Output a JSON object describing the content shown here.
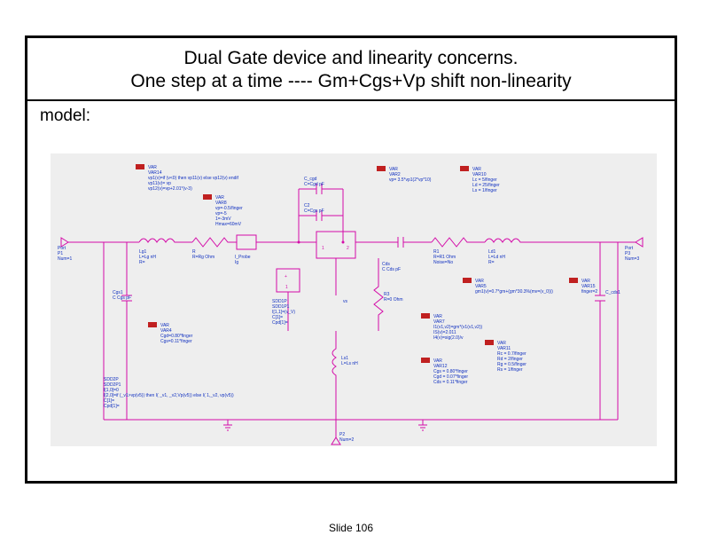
{
  "title": {
    "line1": "Dual Gate device and linearity concerns.",
    "line2": "One step at a time ----    Gm+Cgs+Vp shift non-linearity"
  },
  "model_label": "model:",
  "footer": "Slide 106",
  "schematic": {
    "vars": [
      {
        "id": "VAR14",
        "name": "VAR",
        "lines": [
          "vp1(v)=if (v<0) then vp11(v) else vp12(v) endif",
          "vp11(v)= vp",
          "vp12(v)=vp+2.01*(v-3)"
        ]
      },
      {
        "id": "VAR8",
        "name": "VAR",
        "lines": [
          "vp=-0.5/finger",
          "vp=-5",
          "1=-3mV",
          "Hmax=60mV"
        ]
      },
      {
        "id": "VAR2",
        "name": "VAR",
        "lines": [
          "vp= 3.5*vp1(2*vp*10)"
        ]
      },
      {
        "id": "VAR10",
        "name": "VAR",
        "lines": [
          "Lc = 5/finger",
          "Ld = 25/finger",
          "Ls = 1/finger"
        ]
      },
      {
        "id": "VAR5",
        "name": "VAR",
        "lines": [
          "gm1(v)=0.7*gm+(gm*30.3%(mv=(v_0)))"
        ]
      },
      {
        "id": "VAR15",
        "name": "VAR",
        "lines": [
          "finger=2"
        ]
      },
      {
        "id": "VAR11",
        "name": "VAR",
        "lines": [
          "Rc = 0.7/finger",
          "Rd = 2/finger",
          "Rg = 0.5/finger",
          "Rs = 1/finger"
        ]
      },
      {
        "id": "VAR12",
        "name": "VAR",
        "lines": [
          "Cgs = 0.80*finger",
          "Cgd = 0.07*finger",
          "Cds = 0.11*finger"
        ]
      },
      {
        "id": "VAR4",
        "name": "VAR",
        "lines": [
          "Cgd=0.80*finger",
          "Cgs=0.11*finger"
        ]
      },
      {
        "id": "VAR7",
        "name": "VAR",
        "lines": [
          "I1(v1,v2)=gm*(v1(v1,v2))",
          "IS(v)=2.011",
          "I4(v)=sig(2.0)/v"
        ]
      }
    ],
    "components": {
      "port_in": {
        "ref": "P1",
        "label": "Port",
        "num": "Num=1"
      },
      "port_out": {
        "ref": "P3",
        "label": "Port",
        "num": "Num=3"
      },
      "port_bot": {
        "ref": "P2",
        "label": "Port",
        "num": "Num=2"
      },
      "L_lg1": {
        "ref": "Lg1",
        "val": "L=Lg nH",
        "R": "R="
      },
      "R_rg": {
        "ref": "R",
        "val": "R=Rg Ohm"
      },
      "IP_probe": {
        "ref": "I_Probe",
        "name": "Ig"
      },
      "C_cgd": {
        "ref": "C_cgd",
        "val": "C=Cgd pF"
      },
      "C_cgs": {
        "ref": "C2",
        "val": "C=Cgs pF"
      },
      "C_cds": {
        "ref": "C",
        "name": "Cds",
        "val": "C Cds pF"
      },
      "R1": {
        "ref": "R1",
        "val": "R=R1 Ohm",
        "Noise": "Noise=No"
      },
      "R3": {
        "ref": "R3",
        "val": "R=0 Ohm"
      },
      "L_ld1": {
        "ref": "Ld1",
        "val": "L=Ld nH",
        "R": "R="
      },
      "L_ls1": {
        "ref": "Ls1",
        "val": "L=Ls nH"
      },
      "C_gs1": {
        "ref": "Cgs1",
        "val": "C Cgs pF"
      },
      "C_cds1": {
        "ref": "C_cds1"
      },
      "SDD1P": {
        "ref": "SDD1P1",
        "lines": [
          "I[1,1]=(v_V)",
          "C[1]=",
          "Cpd[1]="
        ]
      },
      "SDD2P": {
        "ref": "SDD2P1",
        "lines": [
          "I[1,0]=0",
          "I[2,0]=if (_v1>vp(v5)) then I( _v1, _v2,Vp(v5)) else I( 1,_v2, vp(v5))",
          "C[1]=",
          "Cpd[1]="
        ]
      }
    }
  }
}
